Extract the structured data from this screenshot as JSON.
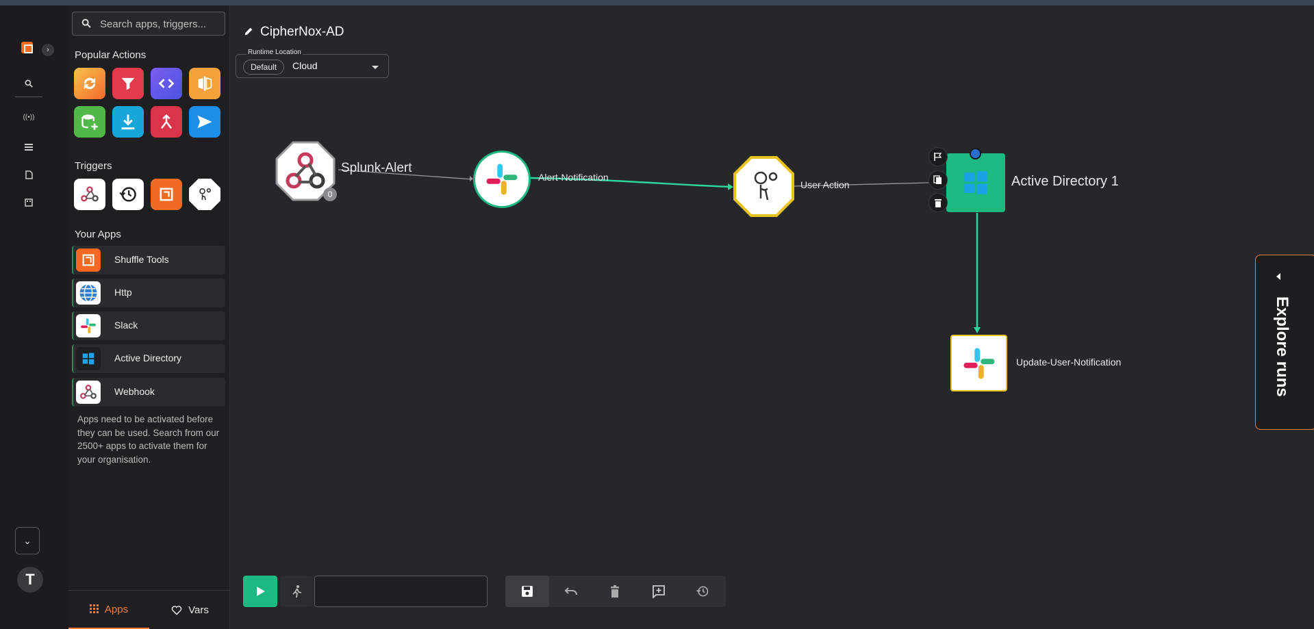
{
  "search": {
    "placeholder": "Search apps, triggers..."
  },
  "sidebar": {
    "popular_title": "Popular Actions",
    "popular_actions": [
      {
        "icon": "refresh-icon",
        "color": "#f7a33a"
      },
      {
        "icon": "filter-icon",
        "color": "#e23b4e"
      },
      {
        "icon": "code-icon",
        "color": "#5b5ef0"
      },
      {
        "icon": "compare-icon",
        "color": "#f5a23a"
      },
      {
        "icon": "database-add-icon",
        "color": "#53b84a"
      },
      {
        "icon": "download-icon",
        "color": "#19a7d9"
      },
      {
        "icon": "merge-icon",
        "color": "#d9344a"
      },
      {
        "icon": "send-icon",
        "color": "#1b8ee8"
      }
    ],
    "triggers_title": "Triggers",
    "triggers": [
      {
        "icon": "webhook-icon"
      },
      {
        "icon": "schedule-icon"
      },
      {
        "icon": "shuffle-trigger-icon"
      },
      {
        "icon": "user-input-icon"
      }
    ],
    "apps_title": "Your Apps",
    "apps": [
      {
        "label": "Shuffle Tools",
        "icon": "shuffle-tools-icon"
      },
      {
        "label": "Http",
        "icon": "http-globe-icon"
      },
      {
        "label": "Slack",
        "icon": "slack-icon"
      },
      {
        "label": "Active Directory",
        "icon": "windows-icon"
      },
      {
        "label": "Webhook",
        "icon": "webhook-icon"
      }
    ],
    "note": "Apps need to be activated before they can be used. Search from our 2500+ apps to activate them for your organisation.",
    "tabs": {
      "apps": "Apps",
      "vars": "Vars"
    }
  },
  "workflow": {
    "title": "CipherNox-AD",
    "runtime_label": "Runtime Location",
    "runtime_chip": "Default",
    "runtime_value": "Cloud"
  },
  "nodes": {
    "splunk": {
      "label": "Splunk-Alert",
      "badge": "0"
    },
    "alert": {
      "label": "Alert-Notification"
    },
    "user": {
      "label": "User Action"
    },
    "ad": {
      "label": "Active Directory 1"
    },
    "update": {
      "label": "Update-User-Notification"
    }
  },
  "explore": {
    "label": "Explore runs"
  },
  "nav": {
    "avatar": "T"
  }
}
